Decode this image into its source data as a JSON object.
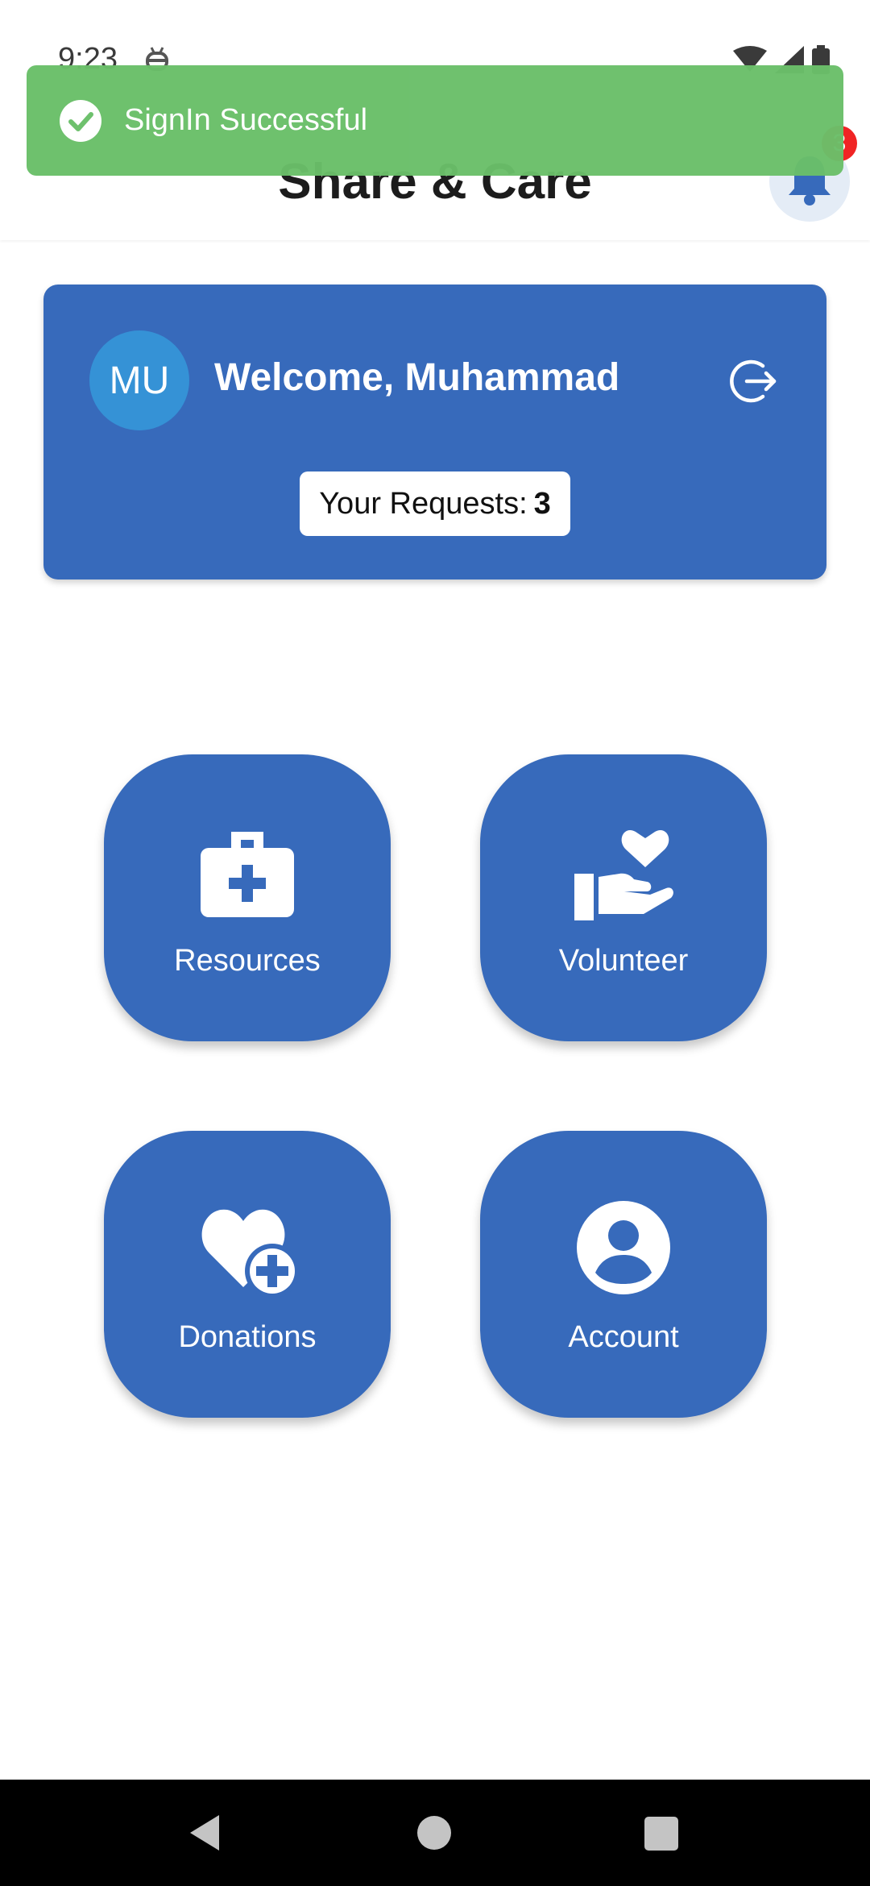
{
  "status_bar": {
    "time": "9:23"
  },
  "header": {
    "title": "Share & Care",
    "notification_count": "3"
  },
  "toast": {
    "message": "SignIn Successful",
    "color": "#6abf69"
  },
  "welcome_card": {
    "avatar_initials": "MU",
    "welcome_text": "Welcome, Muhammad",
    "requests_label": "Your Requests:",
    "requests_count": "3"
  },
  "tiles": [
    {
      "label": "Resources",
      "icon": "medical-kit-icon"
    },
    {
      "label": "Volunteer",
      "icon": "heart-hand-icon"
    },
    {
      "label": "Donations",
      "icon": "heart-plus-icon"
    },
    {
      "label": "Account",
      "icon": "user-circle-icon"
    }
  ],
  "colors": {
    "primary": "#376abb",
    "avatar": "#3592d6",
    "badge": "#f02424",
    "toast": "#6abf69"
  }
}
